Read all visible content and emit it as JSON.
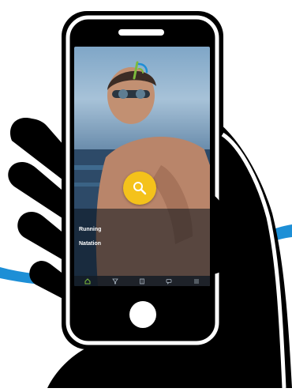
{
  "status_bar": {
    "carrier": "",
    "time": "",
    "battery": ""
  },
  "list": {
    "header": "",
    "items": [
      {
        "title": "Running",
        "subtitle": ""
      },
      {
        "title": "Natation",
        "subtitle": ""
      }
    ]
  },
  "tabs": [
    "home-icon",
    "filter-icon",
    "book-icon",
    "chat-icon",
    "menu-icon"
  ],
  "colors": {
    "hand": "#000000",
    "swoosh": "#1d8fd6",
    "fab": "#f4c21b",
    "logo_green": "#7dbb3c",
    "logo_blue": "#1d8fd6"
  }
}
